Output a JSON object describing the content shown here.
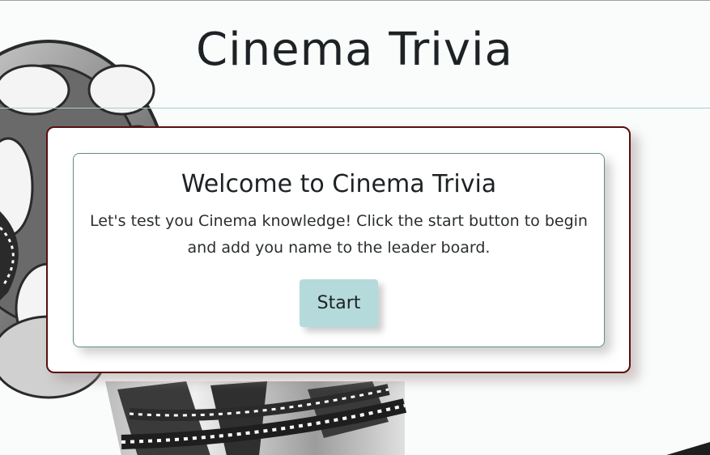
{
  "header": {
    "title": "Cinema Trivia"
  },
  "welcome": {
    "heading": "Welcome to Cinema Trivia",
    "description": "Let's test you Cinema knowledge! Click the start button to begin and add you name to the leader board.",
    "start_label": "Start"
  },
  "colors": {
    "header_rule": "#9fd0cf",
    "outer_border": "#5a0e0e",
    "inner_border": "#5f8f88",
    "start_button_bg": "#b5dadb"
  },
  "background": {
    "icon": "film-reel-icon"
  }
}
